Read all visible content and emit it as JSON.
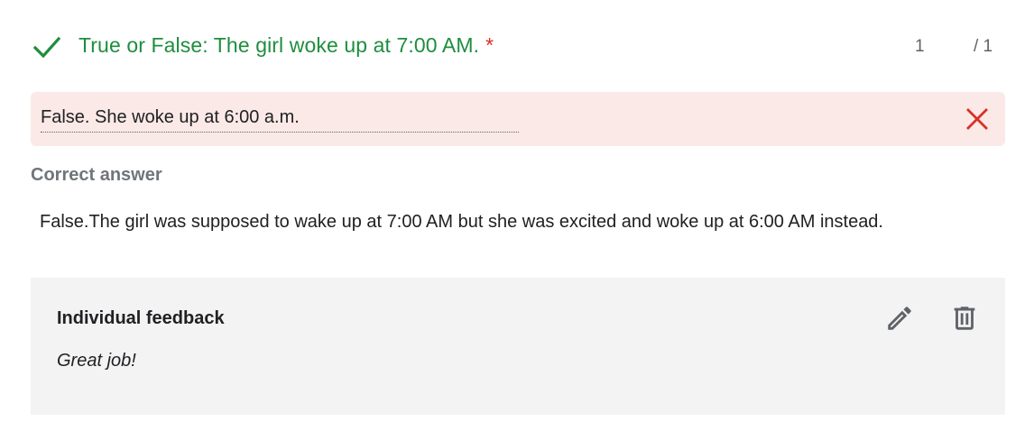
{
  "question": {
    "title": "True or False: The girl woke up at 7:00 AM.",
    "required_marker": "*",
    "score_earned": "1",
    "score_total": "/ 1",
    "status_icon": "check-icon",
    "status_color": "#1e8e3e"
  },
  "response": {
    "text": "False. She woke up at 6:00 a.m.",
    "status_icon": "close-icon",
    "status_color": "#d93025",
    "background": "#fbe9e7"
  },
  "correct_answer": {
    "label": "Correct answer",
    "text": "False.The girl was supposed to wake up at 7:00 AM but she was excited and woke up at 6:00 AM instead."
  },
  "feedback": {
    "title": "Individual feedback",
    "body": "Great job!",
    "edit_icon": "pencil-icon",
    "delete_icon": "trash-icon"
  }
}
